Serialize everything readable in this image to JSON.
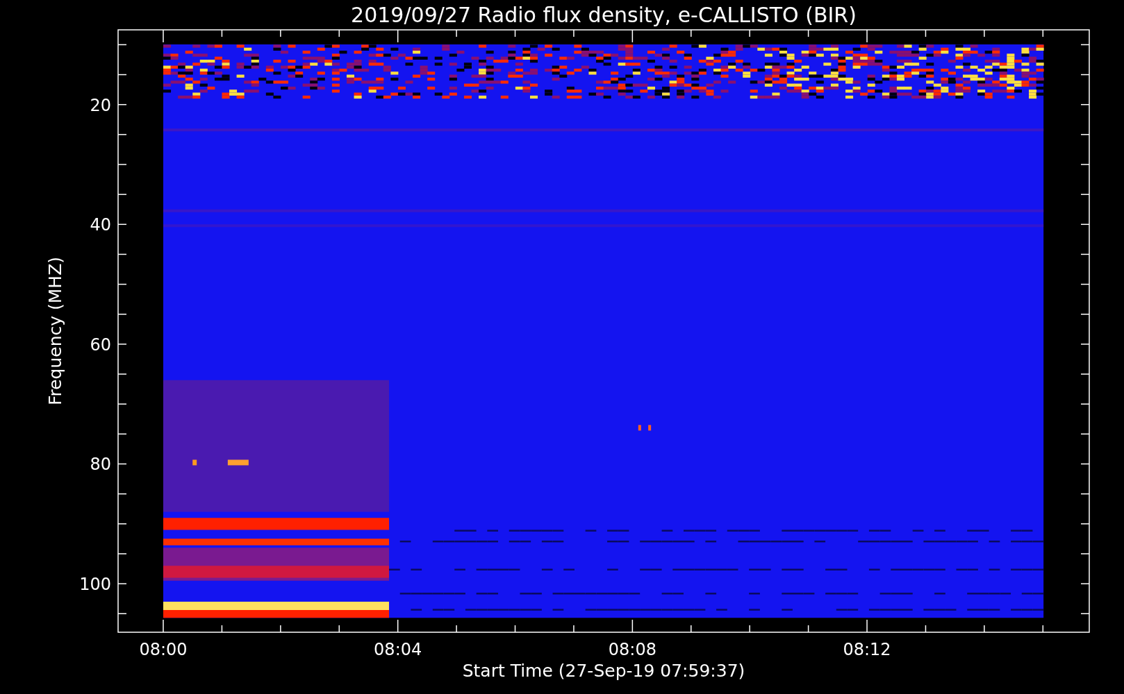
{
  "chart_data": {
    "type": "scatter",
    "title": "2019/09/27  Radio flux density, e-CALLISTO (BIR)",
    "xlabel": "Start Time (27-Sep-19 07:59:37)",
    "ylabel": "Frequency (MHZ)",
    "categories": [
      "08:00",
      null,
      null,
      null,
      "08:04",
      null,
      null,
      null,
      "08:08",
      null,
      null,
      null,
      "08:12",
      null,
      null,
      null
    ],
    "ylim": [
      108.1,
      7.52
    ],
    "yticks": [
      20,
      40,
      60,
      80,
      100
    ]
  }
}
